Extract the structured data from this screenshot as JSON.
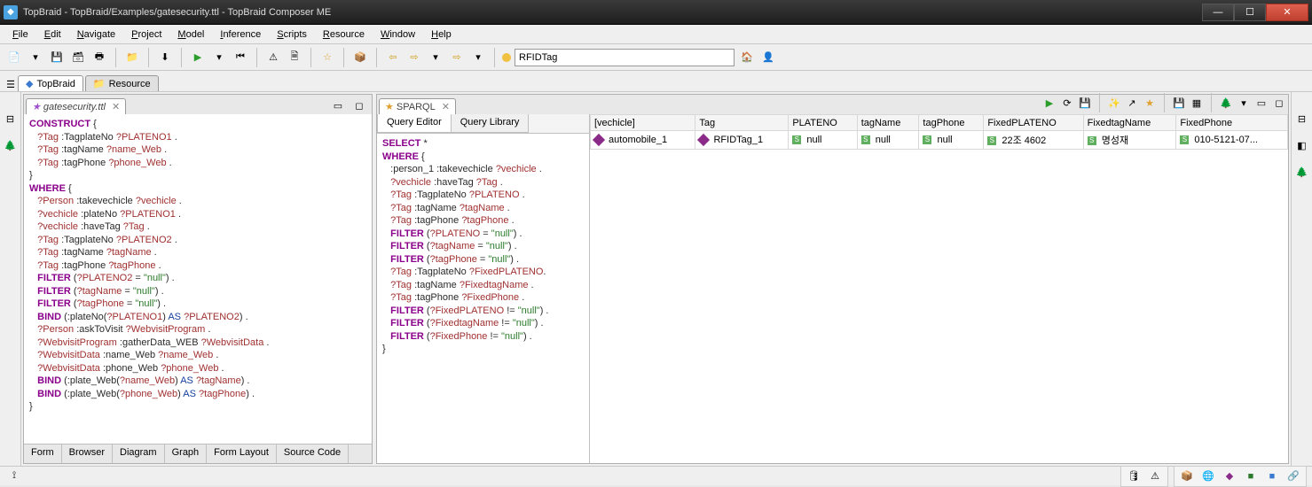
{
  "title": "TopBraid - TopBraid/Examples/gatesecurity.ttl - TopBraid Composer ME",
  "menu": [
    "File",
    "Edit",
    "Navigate",
    "Project",
    "Model",
    "Inference",
    "Scripts",
    "Resource",
    "Window",
    "Help"
  ],
  "toolbar_input": "RFIDTag",
  "viewtabs": {
    "topbraid": "TopBraid",
    "resource": "Resource"
  },
  "lefttab": "gatesecurity.ttl",
  "sparqltab": "SPARQL",
  "subtabs": {
    "qe": "Query Editor",
    "ql": "Query Library"
  },
  "bottom_tabs": [
    "Form",
    "Browser",
    "Diagram",
    "Graph",
    "Form Layout",
    "Source Code"
  ],
  "left_code": [
    {
      "t": "kw",
      "v": "CONSTRUCT"
    },
    {
      "t": "p",
      "v": " {"
    },
    null,
    {
      "t": "ind",
      "v": "   "
    },
    {
      "t": "var",
      "v": "?Tag"
    },
    {
      "t": "p",
      "v": " :TagplateNo "
    },
    {
      "t": "var",
      "v": "?PLATENO1"
    },
    {
      "t": "p",
      "v": " ."
    },
    null,
    {
      "t": "ind",
      "v": "   "
    },
    {
      "t": "var",
      "v": "?Tag"
    },
    {
      "t": "p",
      "v": " :tagName "
    },
    {
      "t": "var",
      "v": "?name_Web"
    },
    {
      "t": "p",
      "v": " ."
    },
    null,
    {
      "t": "ind",
      "v": "   "
    },
    {
      "t": "var",
      "v": "?Tag"
    },
    {
      "t": "p",
      "v": " :tagPhone "
    },
    {
      "t": "var",
      "v": "?phone_Web"
    },
    {
      "t": "p",
      "v": " ."
    },
    null,
    {
      "t": "p",
      "v": "}"
    },
    null,
    {
      "t": "kw",
      "v": "WHERE"
    },
    {
      "t": "p",
      "v": " {"
    },
    null,
    {
      "t": "ind",
      "v": "   "
    },
    {
      "t": "var",
      "v": "?Person"
    },
    {
      "t": "p",
      "v": " :takevechicle "
    },
    {
      "t": "var",
      "v": "?vechicle"
    },
    {
      "t": "p",
      "v": " ."
    },
    null,
    {
      "t": "ind",
      "v": "   "
    },
    {
      "t": "var",
      "v": "?vechicle"
    },
    {
      "t": "p",
      "v": " :plateNo "
    },
    {
      "t": "var",
      "v": "?PLATENO1"
    },
    {
      "t": "p",
      "v": " ."
    },
    null,
    {
      "t": "ind",
      "v": "   "
    },
    {
      "t": "var",
      "v": "?vechicle"
    },
    {
      "t": "p",
      "v": " :haveTag "
    },
    {
      "t": "var",
      "v": "?Tag"
    },
    {
      "t": "p",
      "v": " ."
    },
    null,
    {
      "t": "ind",
      "v": "   "
    },
    {
      "t": "var",
      "v": "?Tag"
    },
    {
      "t": "p",
      "v": " :TagplateNo "
    },
    {
      "t": "var",
      "v": "?PLATENO2"
    },
    {
      "t": "p",
      "v": " ."
    },
    null,
    {
      "t": "ind",
      "v": "   "
    },
    {
      "t": "var",
      "v": "?Tag"
    },
    {
      "t": "p",
      "v": " :tagName "
    },
    {
      "t": "var",
      "v": "?tagName"
    },
    {
      "t": "p",
      "v": " ."
    },
    null,
    {
      "t": "ind",
      "v": "   "
    },
    {
      "t": "var",
      "v": "?Tag"
    },
    {
      "t": "p",
      "v": " :tagPhone "
    },
    {
      "t": "var",
      "v": "?tagPhone"
    },
    {
      "t": "p",
      "v": " ."
    },
    null,
    {
      "t": "ind",
      "v": "   "
    },
    {
      "t": "kw",
      "v": "FILTER"
    },
    {
      "t": "p",
      "v": " ("
    },
    {
      "t": "var",
      "v": "?PLATENO2"
    },
    {
      "t": "p",
      "v": " = "
    },
    {
      "t": "str",
      "v": "\"null\""
    },
    {
      "t": "p",
      "v": ") ."
    },
    null,
    {
      "t": "ind",
      "v": "   "
    },
    {
      "t": "kw",
      "v": "FILTER"
    },
    {
      "t": "p",
      "v": " ("
    },
    {
      "t": "var",
      "v": "?tagName"
    },
    {
      "t": "p",
      "v": " = "
    },
    {
      "t": "str",
      "v": "\"null\""
    },
    {
      "t": "p",
      "v": ") ."
    },
    null,
    {
      "t": "ind",
      "v": "   "
    },
    {
      "t": "kw",
      "v": "FILTER"
    },
    {
      "t": "p",
      "v": " ("
    },
    {
      "t": "var",
      "v": "?tagPhone"
    },
    {
      "t": "p",
      "v": " = "
    },
    {
      "t": "str",
      "v": "\"null\""
    },
    {
      "t": "p",
      "v": ") ."
    },
    null,
    {
      "t": "ind",
      "v": "   "
    },
    {
      "t": "kw",
      "v": "BIND"
    },
    {
      "t": "p",
      "v": " (:plateNo("
    },
    {
      "t": "var",
      "v": "?PLATENO1"
    },
    {
      "t": "p",
      "v": ") "
    },
    {
      "t": "kw2",
      "v": "AS"
    },
    {
      "t": "p",
      "v": " "
    },
    {
      "t": "var",
      "v": "?PLATENO2"
    },
    {
      "t": "p",
      "v": ") ."
    },
    null,
    {
      "t": "ind",
      "v": "   "
    },
    {
      "t": "var",
      "v": "?Person"
    },
    {
      "t": "p",
      "v": " :askToVisit "
    },
    {
      "t": "var",
      "v": "?WebvisitProgram"
    },
    {
      "t": "p",
      "v": " ."
    },
    null,
    {
      "t": "ind",
      "v": "   "
    },
    {
      "t": "var",
      "v": "?WebvisitProgram"
    },
    {
      "t": "p",
      "v": " :gatherData_WEB "
    },
    {
      "t": "var",
      "v": "?WebvisitData"
    },
    {
      "t": "p",
      "v": " ."
    },
    null,
    {
      "t": "ind",
      "v": "   "
    },
    {
      "t": "var",
      "v": "?WebvisitData"
    },
    {
      "t": "p",
      "v": " :name_Web "
    },
    {
      "t": "var",
      "v": "?name_Web"
    },
    {
      "t": "p",
      "v": " ."
    },
    null,
    {
      "t": "ind",
      "v": "   "
    },
    {
      "t": "var",
      "v": "?WebvisitData"
    },
    {
      "t": "p",
      "v": " :phone_Web "
    },
    {
      "t": "var",
      "v": "?phone_Web"
    },
    {
      "t": "p",
      "v": " ."
    },
    null,
    {
      "t": "ind",
      "v": "   "
    },
    {
      "t": "kw",
      "v": "BIND"
    },
    {
      "t": "p",
      "v": " (:plate_Web("
    },
    {
      "t": "var",
      "v": "?name_Web"
    },
    {
      "t": "p",
      "v": ") "
    },
    {
      "t": "kw2",
      "v": "AS"
    },
    {
      "t": "p",
      "v": " "
    },
    {
      "t": "var",
      "v": "?tagName"
    },
    {
      "t": "p",
      "v": ") ."
    },
    null,
    {
      "t": "ind",
      "v": "   "
    },
    {
      "t": "kw",
      "v": "BIND"
    },
    {
      "t": "p",
      "v": " (:plate_Web("
    },
    {
      "t": "var",
      "v": "?phone_Web"
    },
    {
      "t": "p",
      "v": ") "
    },
    {
      "t": "kw2",
      "v": "AS"
    },
    {
      "t": "p",
      "v": " "
    },
    {
      "t": "var",
      "v": "?tagPhone"
    },
    {
      "t": "p",
      "v": ") ."
    },
    null,
    {
      "t": "p",
      "v": "}"
    }
  ],
  "sparql_code": [
    {
      "t": "kw",
      "v": "SELECT"
    },
    {
      "t": "p",
      "v": " *"
    },
    null,
    {
      "t": "kw",
      "v": "WHERE"
    },
    {
      "t": "p",
      "v": " {"
    },
    null,
    {
      "t": "ind",
      "v": "   "
    },
    {
      "t": "p",
      "v": ":person_1 :takevechicle "
    },
    {
      "t": "var",
      "v": "?vechicle"
    },
    {
      "t": "p",
      "v": " ."
    },
    null,
    {
      "t": "ind",
      "v": "   "
    },
    {
      "t": "var",
      "v": "?vechicle"
    },
    {
      "t": "p",
      "v": " :haveTag "
    },
    {
      "t": "var",
      "v": "?Tag"
    },
    {
      "t": "p",
      "v": " ."
    },
    null,
    {
      "t": "ind",
      "v": "   "
    },
    {
      "t": "var",
      "v": "?Tag"
    },
    {
      "t": "p",
      "v": " :TagplateNo "
    },
    {
      "t": "var",
      "v": "?PLATENO"
    },
    {
      "t": "p",
      "v": " ."
    },
    null,
    {
      "t": "ind",
      "v": "   "
    },
    {
      "t": "var",
      "v": "?Tag"
    },
    {
      "t": "p",
      "v": " :tagName "
    },
    {
      "t": "var",
      "v": "?tagName"
    },
    {
      "t": "p",
      "v": " ."
    },
    null,
    {
      "t": "ind",
      "v": "   "
    },
    {
      "t": "var",
      "v": "?Tag"
    },
    {
      "t": "p",
      "v": " :tagPhone "
    },
    {
      "t": "var",
      "v": "?tagPhone"
    },
    {
      "t": "p",
      "v": " ."
    },
    null,
    {
      "t": "ind",
      "v": "   "
    },
    {
      "t": "kw",
      "v": "FILTER"
    },
    {
      "t": "p",
      "v": " ("
    },
    {
      "t": "var",
      "v": "?PLATENO"
    },
    {
      "t": "p",
      "v": " = "
    },
    {
      "t": "str",
      "v": "\"null\""
    },
    {
      "t": "p",
      "v": ") ."
    },
    null,
    {
      "t": "ind",
      "v": "   "
    },
    {
      "t": "kw",
      "v": "FILTER"
    },
    {
      "t": "p",
      "v": " ("
    },
    {
      "t": "var",
      "v": "?tagName"
    },
    {
      "t": "p",
      "v": " = "
    },
    {
      "t": "str",
      "v": "\"null\""
    },
    {
      "t": "p",
      "v": ") ."
    },
    null,
    {
      "t": "ind",
      "v": "   "
    },
    {
      "t": "kw",
      "v": "FILTER"
    },
    {
      "t": "p",
      "v": " ("
    },
    {
      "t": "var",
      "v": "?tagPhone"
    },
    {
      "t": "p",
      "v": " = "
    },
    {
      "t": "str",
      "v": "\"null\""
    },
    {
      "t": "p",
      "v": ") ."
    },
    null,
    {
      "t": "ind",
      "v": "   "
    },
    {
      "t": "var",
      "v": "?Tag"
    },
    {
      "t": "p",
      "v": " :TagplateNo "
    },
    {
      "t": "var",
      "v": "?FixedPLATENO"
    },
    {
      "t": "p",
      "v": "."
    },
    null,
    {
      "t": "ind",
      "v": "   "
    },
    {
      "t": "var",
      "v": "?Tag"
    },
    {
      "t": "p",
      "v": " :tagName "
    },
    {
      "t": "var",
      "v": "?FixedtagName"
    },
    {
      "t": "p",
      "v": " ."
    },
    null,
    {
      "t": "ind",
      "v": "   "
    },
    {
      "t": "var",
      "v": "?Tag"
    },
    {
      "t": "p",
      "v": " :tagPhone "
    },
    {
      "t": "var",
      "v": "?FixedPhone"
    },
    {
      "t": "p",
      "v": " ."
    },
    null,
    {
      "t": "ind",
      "v": "   "
    },
    {
      "t": "kw",
      "v": "FILTER"
    },
    {
      "t": "p",
      "v": " ("
    },
    {
      "t": "var",
      "v": "?FixedPLATENO"
    },
    {
      "t": "p",
      "v": " != "
    },
    {
      "t": "str",
      "v": "\"null\""
    },
    {
      "t": "p",
      "v": ") ."
    },
    null,
    {
      "t": "ind",
      "v": "   "
    },
    {
      "t": "kw",
      "v": "FILTER"
    },
    {
      "t": "p",
      "v": " ("
    },
    {
      "t": "var",
      "v": "?FixedtagName"
    },
    {
      "t": "p",
      "v": " != "
    },
    {
      "t": "str",
      "v": "\"null\""
    },
    {
      "t": "p",
      "v": ") ."
    },
    null,
    {
      "t": "ind",
      "v": "   "
    },
    {
      "t": "kw",
      "v": "FILTER"
    },
    {
      "t": "p",
      "v": " ("
    },
    {
      "t": "var",
      "v": "?FixedPhone"
    },
    {
      "t": "p",
      "v": " != "
    },
    {
      "t": "str",
      "v": "\"null\""
    },
    {
      "t": "p",
      "v": ") ."
    },
    null,
    {
      "t": "p",
      "v": "}"
    }
  ],
  "result_headers": [
    "[vechicle]",
    "Tag",
    "PLATENO",
    "tagName",
    "tagPhone",
    "FixedPLATENO",
    "FixedtagName",
    "FixedPhone"
  ],
  "result_row": [
    {
      "icon": "diamond",
      "v": "automobile_1"
    },
    {
      "icon": "diamond",
      "v": "RFIDTag_1"
    },
    {
      "icon": "s",
      "v": "null"
    },
    {
      "icon": "s",
      "v": "null"
    },
    {
      "icon": "s",
      "v": "null"
    },
    {
      "icon": "s",
      "v": "22조 4602"
    },
    {
      "icon": "s",
      "v": "명성재"
    },
    {
      "icon": "s",
      "v": "010-5121-07..."
    }
  ]
}
